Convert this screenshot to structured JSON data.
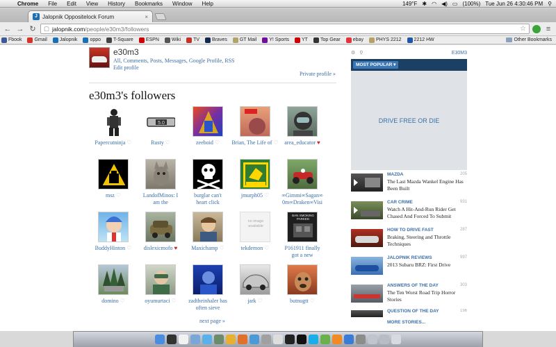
{
  "menubar": {
    "app_name": "Chrome",
    "items": [
      "File",
      "Edit",
      "View",
      "History",
      "Bookmarks",
      "Window",
      "Help"
    ],
    "temperature": "149°F",
    "battery": "(100%)",
    "datetime": "Tue Jun 26  4:30:46 PM"
  },
  "tab": {
    "title": "Jalopnik Oppositelock Forum",
    "close": "×"
  },
  "address": {
    "host": "jalopnik.com",
    "path": "/people/e30m3/followers"
  },
  "bookmarks": {
    "items": [
      {
        "label": "Fbook",
        "color": "#3b5998"
      },
      {
        "label": "Gmail",
        "color": "#d93025"
      },
      {
        "label": "Jalopnik",
        "color": "#1a6fb4"
      },
      {
        "label": "oppo",
        "color": "#1a6fb4"
      },
      {
        "label": "T-Square",
        "color": "#444444"
      },
      {
        "label": "ESPN",
        "color": "#cc0000"
      },
      {
        "label": "Wiki",
        "color": "#555555"
      },
      {
        "label": "TV",
        "color": "#c4302b"
      },
      {
        "label": "Braves",
        "color": "#13274f"
      },
      {
        "label": "GT Mail",
        "color": "#b3a369"
      },
      {
        "label": "Y! Sports",
        "color": "#720e9e"
      },
      {
        "label": "YT",
        "color": "#cc0000"
      },
      {
        "label": "Top Gear",
        "color": "#333333"
      },
      {
        "label": "ebay",
        "color": "#e53238"
      },
      {
        "label": "PHYS 2212",
        "color": "#b3a369"
      },
      {
        "label": "2212 HW",
        "color": "#2255aa"
      }
    ],
    "other": "Other Bookmarks"
  },
  "profile": {
    "username": "e30m3",
    "links": [
      "All",
      "Comments",
      "Posts",
      "Messages",
      "Google Profile",
      "RSS"
    ],
    "edit": "Edit profile",
    "private": "Private profile »"
  },
  "page_title": "e30m3's followers",
  "followers": [
    {
      "name": "Papercutninja",
      "heart": false,
      "lines": [
        "Papercutninja"
      ]
    },
    {
      "name": "Rusty",
      "heart": false,
      "lines": [
        "Rusty"
      ]
    },
    {
      "name": "zeeboid",
      "heart": false,
      "lines": [
        "zeeboid"
      ]
    },
    {
      "name": "Brian, The Life of",
      "heart": false,
      "lines": [
        "Brian, The Life of"
      ]
    },
    {
      "name": "area_educator",
      "heart": true,
      "lines": [
        "area_educator"
      ]
    },
    {
      "name": "msz",
      "heart": false,
      "lines": [
        "msz"
      ]
    },
    {
      "name": "LandofMinos: I am the",
      "heart": false,
      "lines": [
        "LandofMinos: I",
        "am the"
      ]
    },
    {
      "name": "burglar can't heart click",
      "heart": false,
      "lines": [
        "burglar can't",
        "heart click"
      ]
    },
    {
      "name": "jmurph05",
      "heart": false,
      "lines": [
        "jmurph05"
      ]
    },
    {
      "name": "∞GimmiSagan∞ 0m∞Draken∞Visi",
      "heart": false,
      "lines": [
        "∞Gimmi∞Sagan∞",
        "0m∞Draken∞Visi"
      ]
    },
    {
      "name": "BuddyHinton",
      "heart": false,
      "lines": [
        "BuddyHinton"
      ]
    },
    {
      "name": "dislexicmofo",
      "heart": true,
      "lines": [
        "dislexicmofo"
      ]
    },
    {
      "name": "Maxichamp",
      "heart": false,
      "lines": [
        "Maxichamp"
      ]
    },
    {
      "name": "tekdemon",
      "heart": false,
      "lines": [
        "tekdemon"
      ]
    },
    {
      "name": "P161911 finally got a new",
      "heart": false,
      "lines": [
        "P161911 finally",
        "got a new"
      ]
    },
    {
      "name": "domino",
      "heart": false,
      "lines": [
        "domino"
      ]
    },
    {
      "name": "oyumurtaci",
      "heart": false,
      "lines": [
        "oyumurtaci"
      ]
    },
    {
      "name": "zadtheinhaler has often sieve",
      "heart": false,
      "lines": [
        "zadtheinhaler has",
        "often sieve"
      ]
    },
    {
      "name": "jark",
      "heart": false,
      "lines": [
        "jark"
      ]
    },
    {
      "name": "butnugtt",
      "heart": false,
      "lines": [
        "butnugtt"
      ]
    }
  ],
  "thumb_text": {
    "no_image": "no image available",
    "ban_caption": "BAN SMOKING PARKED"
  },
  "next_page": "next page »",
  "sidebar": {
    "user": "E30M3",
    "popular": "MOST POPULAR ▾",
    "ad_text": "DRIVE FREE OR DIE",
    "stories": [
      {
        "category": "MAZDA",
        "count": "205",
        "headline": "The Last Mazda Wankel Engine Has Been Built"
      },
      {
        "category": "CAR CRIME",
        "count": "931",
        "headline": "Watch A Hit-And-Run Rider Get Chased And Forced To Submit"
      },
      {
        "category": "HOW TO DRIVE FAST",
        "count": "287",
        "headline": "Braking, Steering and Throttle Techniques"
      },
      {
        "category": "JALOPNIK REVIEWS",
        "count": "997",
        "headline": "2013 Subaru BRZ: First Drive"
      },
      {
        "category": "ANSWERS OF THE DAY",
        "count": "303",
        "headline": "The Ten Worst Road Trip Horror Stories"
      },
      {
        "category": "QUESTION OF THE DAY",
        "count": "196",
        "headline": ""
      }
    ],
    "more": "MORE STORIES..."
  }
}
